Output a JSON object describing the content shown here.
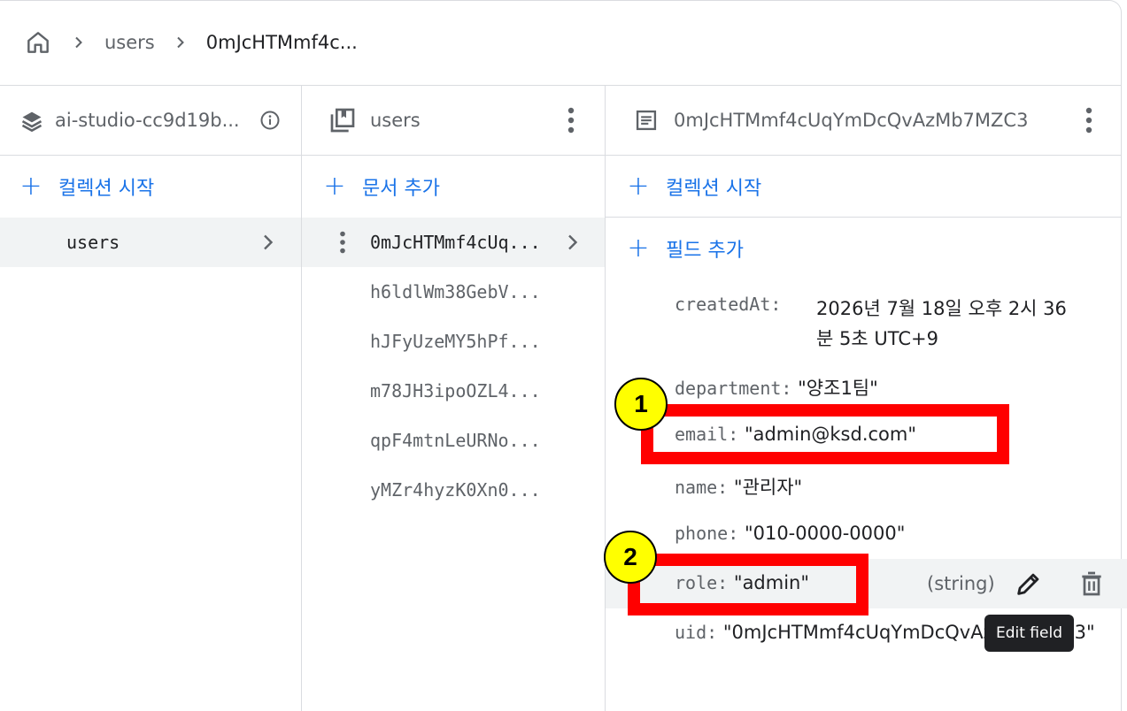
{
  "breadcrumb": {
    "items": [
      "users",
      "0mJcHTMmf4c..."
    ]
  },
  "columns": {
    "project": {
      "title": "ai-studio-cc9d19b...",
      "add_label": "컬렉션 시작",
      "items": [
        "users"
      ]
    },
    "collection": {
      "title": "users",
      "add_label": "문서 추가",
      "items": [
        "0mJcHTMmf4cUq...",
        "h6ldlWm38GebV...",
        "hJFyUzeMY5hPf...",
        "m78JH3ipoOZL4...",
        "qpF4mtnLeURNo...",
        "yMZr4hyzK0Xn0..."
      ]
    },
    "document": {
      "title": "0mJcHTMmf4cUqYmDcQvAzMb7MZC3",
      "add_collection_label": "컬렉션 시작",
      "add_field_label": "필드 추가",
      "fields": [
        {
          "key": "createdAt:",
          "value_line1": "2026년 7월 18일 오후 2시 36",
          "value_line2": "분 5초 UTC+9"
        },
        {
          "key": "department:",
          "value": "\"양조1팀\""
        },
        {
          "key": "email:",
          "value": "\"admin@ksd.com\""
        },
        {
          "key": "name:",
          "value": "\"관리자\""
        },
        {
          "key": "phone:",
          "value": "\"010-0000-0000\""
        },
        {
          "key": "role:",
          "value": "\"admin\"",
          "type": "(string)"
        },
        {
          "key": "uid:",
          "value": "\"0mJcHTMmf4cUqYmDcQvAzMb7MZC3\""
        }
      ]
    }
  },
  "tooltip": "Edit field",
  "annotations": {
    "badge1": "1",
    "badge2": "2"
  },
  "colors": {
    "accent": "#1a73e8",
    "highlight": "#ff0000",
    "badge": "#ffff00"
  }
}
